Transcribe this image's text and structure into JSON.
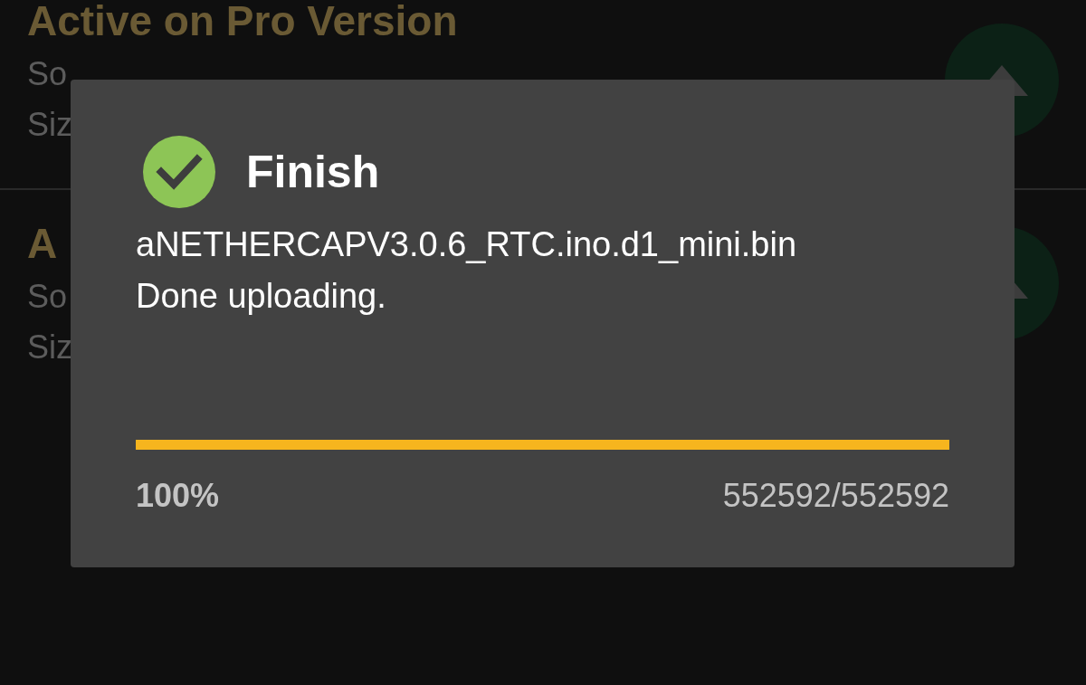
{
  "background_list": [
    {
      "title": "Active on Pro Version",
      "source": "So",
      "size": "Siz"
    },
    {
      "title": "A",
      "source": "So",
      "size": "Siz"
    }
  ],
  "dialog": {
    "title": "Finish",
    "file_name": "aNETHERCAPV3.0.6_RTC.ino.d1_mini.bin",
    "message": "Done uploading.",
    "progress": {
      "level": 1.0,
      "percent": "100%",
      "count": "552592/552592"
    }
  }
}
